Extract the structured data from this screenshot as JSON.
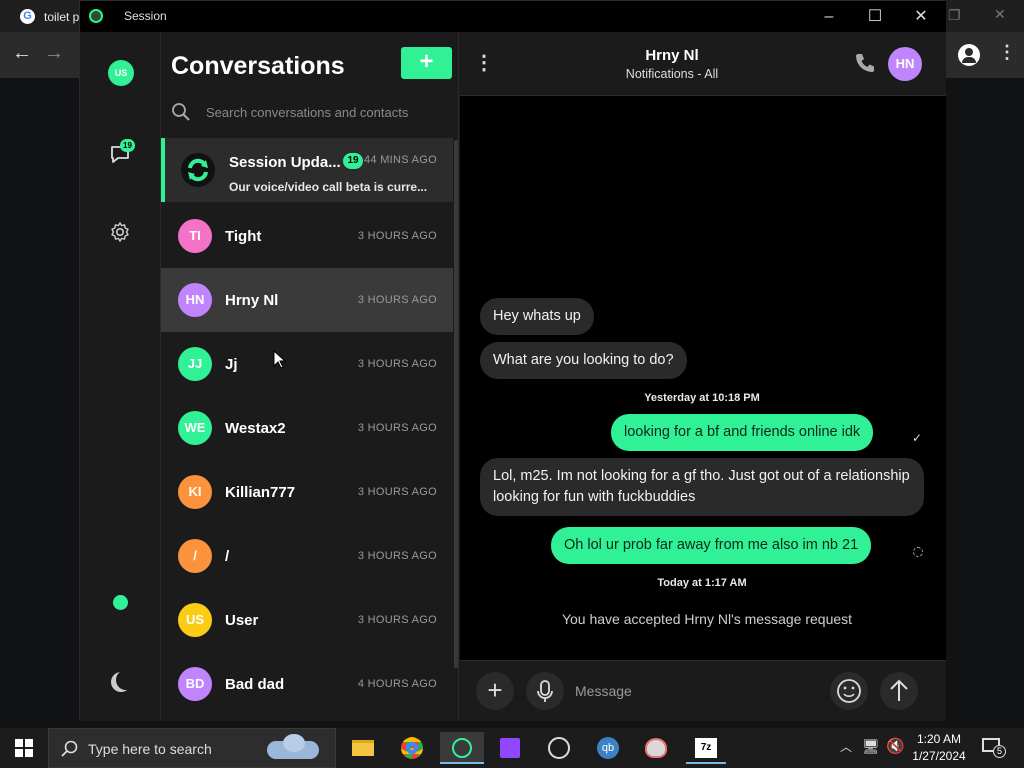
{
  "browser": {
    "tab_title": "toilet p",
    "back_icon": "←",
    "forward_icon": "→"
  },
  "session": {
    "app_title": "Session",
    "sidebar": {
      "avatar_initials": "US",
      "unread_badge": "19"
    },
    "conversations": {
      "heading": "Conversations",
      "new_button": "+",
      "search_placeholder": "Search conversations and contacts",
      "items": [
        {
          "initials": "",
          "name": "Session Upda...",
          "time": "44 MINS AGO",
          "badge": "19",
          "preview": "Our voice/video call beta is curre..."
        },
        {
          "initials": "TI",
          "name": "Tight",
          "time": "3 HOURS AGO",
          "color": "#f472c8"
        },
        {
          "initials": "HN",
          "name": "Hrny Nl",
          "time": "3 HOURS AGO",
          "color": "#c084fc"
        },
        {
          "initials": "JJ",
          "name": "Jj",
          "time": "3 HOURS AGO",
          "color": "#31f196"
        },
        {
          "initials": "WE",
          "name": "Westax2",
          "time": "3 HOURS AGO",
          "color": "#31f196"
        },
        {
          "initials": "KI",
          "name": "Killian777",
          "time": "3 HOURS AGO",
          "color": "#fb923c"
        },
        {
          "initials": "/",
          "name": "/",
          "time": "3 HOURS AGO",
          "color": "#fb923c"
        },
        {
          "initials": "US",
          "name": "User",
          "time": "3 HOURS AGO",
          "color": "#facc15"
        },
        {
          "initials": "BD",
          "name": "Bad dad",
          "time": "4 HOURS AGO",
          "color": "#c084fc"
        }
      ]
    },
    "chat": {
      "contact_name": "Hrny Nl",
      "subtitle": "Notifications - All",
      "contact_initials": "HN",
      "messages": [
        {
          "dir": "in",
          "text": "Hey whats up"
        },
        {
          "dir": "in",
          "text": "What are you looking to do?"
        },
        {
          "dir": "sep",
          "text": "Yesterday at 10:18 PM"
        },
        {
          "dir": "out",
          "text": "looking for a bf and friends online idk"
        },
        {
          "dir": "in",
          "text": "Lol, m25. Im not looking for a gf tho. Just got out of a relationship looking for fun with fuckbuddies"
        },
        {
          "dir": "out",
          "text": "Oh lol ur prob far away from me also im nb 21"
        },
        {
          "dir": "sep",
          "text": "Today at 1:17 AM"
        },
        {
          "dir": "info",
          "text": "You have accepted Hrny Nl's message request"
        }
      ],
      "composer_placeholder": "Message"
    }
  },
  "taskbar": {
    "search_placeholder": "Type here to search",
    "time": "1:20 AM",
    "date": "1/27/2024",
    "notification_count": "5"
  },
  "colors": {
    "accent": "#31f196",
    "bubble_in": "#2a2a2a",
    "selected_row": "#3a3a3a"
  }
}
